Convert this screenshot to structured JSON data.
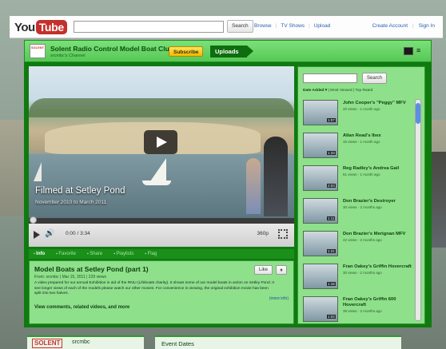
{
  "topbar": {
    "logo_you": "You",
    "logo_tube": "Tube",
    "search_button": "Search",
    "nav": [
      "Browse",
      "TV Shows",
      "Upload"
    ],
    "account": [
      "Create Account",
      "Sign In"
    ]
  },
  "channel": {
    "avatar_text": "SOLENT",
    "title": "Solent Radio Control Model Boat Club",
    "subtitle": "srcmbc's Channel",
    "subscribe": "Subscribe",
    "uploads": "Uploads",
    "grid_view_icon": "grid-view-icon",
    "list_view_icon": "list-view-icon"
  },
  "player": {
    "overlay_title": "Filmed at Setley Pond",
    "overlay_subtitle": "November 2010 to March 2011",
    "time": "0:00 / 3:34",
    "quality": "360p",
    "progress_fraction": 0.0
  },
  "tabs": [
    "Info",
    "Favorite",
    "Share",
    "Playlists",
    "Flag"
  ],
  "info": {
    "title": "Model Boats at Setley Pond (part 1)",
    "meta": "From: srcmbc | Mar 15, 2011 | 229 views",
    "description": "A video prepared for our annual Exhibition in aid of the RNLI (Lifeboats charity). It shows some of our model boats in action on Setley Pond. It see longer views of each of the models please watch our other movies. For convenience in viewing, the original exhibition movie has been split into two halves.",
    "more_info": "(more info)",
    "link": "View comments, related videos, and more",
    "like": "Like"
  },
  "sidebar": {
    "search_button": "Search",
    "sort_active": "Date Added ▾",
    "sort_options": [
      "Most Viewed",
      "Top Rated"
    ],
    "items": [
      {
        "title": "John Cooper's \"Peggy\" MFV",
        "meta": "20 views - 1 month ago",
        "duration": "1:07"
      },
      {
        "title": "Allan Read's Ibex",
        "meta": "15 views - 1 month ago",
        "duration": "1:33"
      },
      {
        "title": "Reg Radley's Andrea Gail",
        "meta": "61 views - 1 month ago",
        "duration": "2:03"
      },
      {
        "title": "Don Brazier's Destroyer",
        "meta": "30 views - 2 months ago",
        "duration": "1:11"
      },
      {
        "title": "Don Brazier's Merignan MFV",
        "meta": "42 views - 2 months ago",
        "duration": "1:21"
      },
      {
        "title": "Fran Oakey's Griffin Hovercraft",
        "meta": "30 views - 2 months ago",
        "duration": "1:18"
      },
      {
        "title": "Fran Oakey's Griffin 600 Hovercraft",
        "meta": "38 views - 2 months ago",
        "duration": "1:03"
      }
    ]
  },
  "lower": {
    "logo": "SOLENT",
    "name": "srcmbc",
    "events": "Event Dates"
  }
}
